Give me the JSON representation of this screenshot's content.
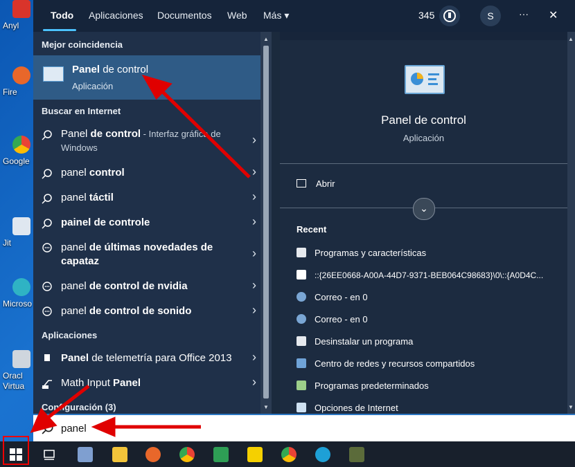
{
  "desktop_icons": [
    {
      "label": "Anyl"
    },
    {
      "label": "Fire"
    },
    {
      "label": "Google"
    },
    {
      "label": "Jit"
    },
    {
      "label": "Microso"
    },
    {
      "label": "Oracl Virtua"
    }
  ],
  "tabs": [
    "Todo",
    "Aplicaciones",
    "Documentos",
    "Web",
    "Más ▾"
  ],
  "header": {
    "points": "345",
    "avatar": "S",
    "more": "···",
    "close": "✕"
  },
  "left": {
    "best_match_header": "Mejor coincidencia",
    "best_match": {
      "title_bold": "Panel",
      "title_rest": " de control",
      "subtitle": "Aplicación"
    },
    "internet_header": "Buscar en Internet",
    "internet_items": [
      {
        "a": "Panel ",
        "b": "de control",
        "c": " - Interfaz gráfica de Windows"
      },
      {
        "a": "panel ",
        "b": "control",
        "c": ""
      },
      {
        "a": "panel ",
        "b": "táctil",
        "c": ""
      },
      {
        "a": "",
        "b": "painel de controle",
        "c": ""
      },
      {
        "a": "panel ",
        "b": "de últimas novedades de capataz",
        "c": ""
      },
      {
        "a": "panel ",
        "b": "de control de nvidia",
        "c": ""
      },
      {
        "a": "panel ",
        "b": "de control de sonido",
        "c": ""
      }
    ],
    "apps_header": "Aplicaciones",
    "apps": [
      {
        "a": "Panel",
        "b": " de telemetría para Office 2013"
      },
      {
        "a": "Math Input ",
        "b": "Panel"
      }
    ],
    "config_header": "Configuración (3)"
  },
  "right": {
    "title": "Panel de control",
    "subtitle": "Aplicación",
    "open": "Abrir",
    "recent_header": "Recent",
    "recent": [
      "Programas y características",
      "::{26EE0668-A00A-44D7-9371-BEB064C98683}\\0\\::{A0D4C...",
      "Correo - en 0",
      "Correo - en 0",
      "Desinstalar un programa",
      "Centro de redes y recursos compartidos",
      "Programas predeterminados",
      "Opciones de Internet"
    ]
  },
  "search": {
    "value": "panel"
  },
  "colors": {
    "accent": "#4cc2ff",
    "highlight": "#2f5b86",
    "annotation": "#e00000"
  }
}
